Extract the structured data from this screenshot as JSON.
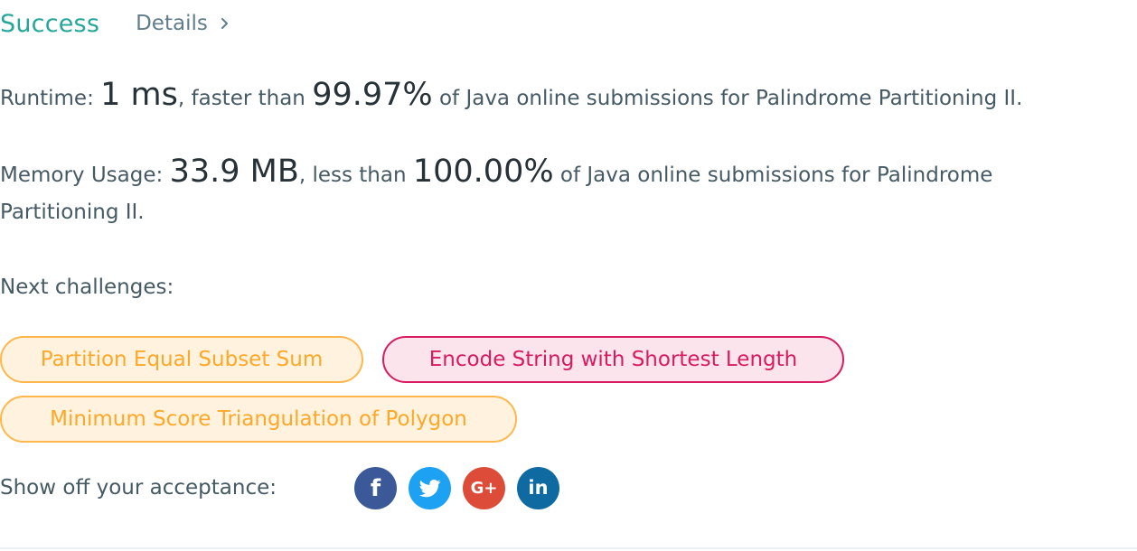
{
  "header": {
    "status": "Success",
    "details_label": "Details"
  },
  "runtime": {
    "label": "Runtime: ",
    "value": "1 ms",
    "comparison": ", faster than ",
    "percent": "99.97%",
    "suffix": " of Java online submissions for Palindrome Partitioning II."
  },
  "memory": {
    "label": "Memory Usage: ",
    "value": "33.9 MB",
    "comparison": ", less than ",
    "percent": "100.00%",
    "suffix": " of Java online submissions for Palindrome",
    "suffix_line2": "Partitioning II."
  },
  "next": {
    "label": "Next challenges:",
    "challenges": [
      {
        "title": "Partition Equal Subset Sum",
        "difficulty": "medium"
      },
      {
        "title": "Encode String with Shortest Length",
        "difficulty": "hard"
      },
      {
        "title": "Minimum Score Triangulation of Polygon",
        "difficulty": "medium"
      }
    ]
  },
  "share": {
    "label": "Show off your acceptance:",
    "networks": [
      {
        "name": "facebook",
        "icon": "facebook-icon",
        "glyph": "f",
        "color": "#3b5998"
      },
      {
        "name": "twitter",
        "icon": "twitter-icon",
        "glyph": "",
        "color": "#1da1f2"
      },
      {
        "name": "google-plus",
        "icon": "google-plus-icon",
        "glyph": "G+",
        "color": "#dd4b39"
      },
      {
        "name": "linkedin",
        "icon": "linkedin-icon",
        "glyph": "in",
        "color": "#0e6aa0"
      }
    ]
  },
  "colors": {
    "success": "#26a69a",
    "medium": "#ffa726",
    "hard": "#d81b60",
    "text": "#455a64"
  }
}
